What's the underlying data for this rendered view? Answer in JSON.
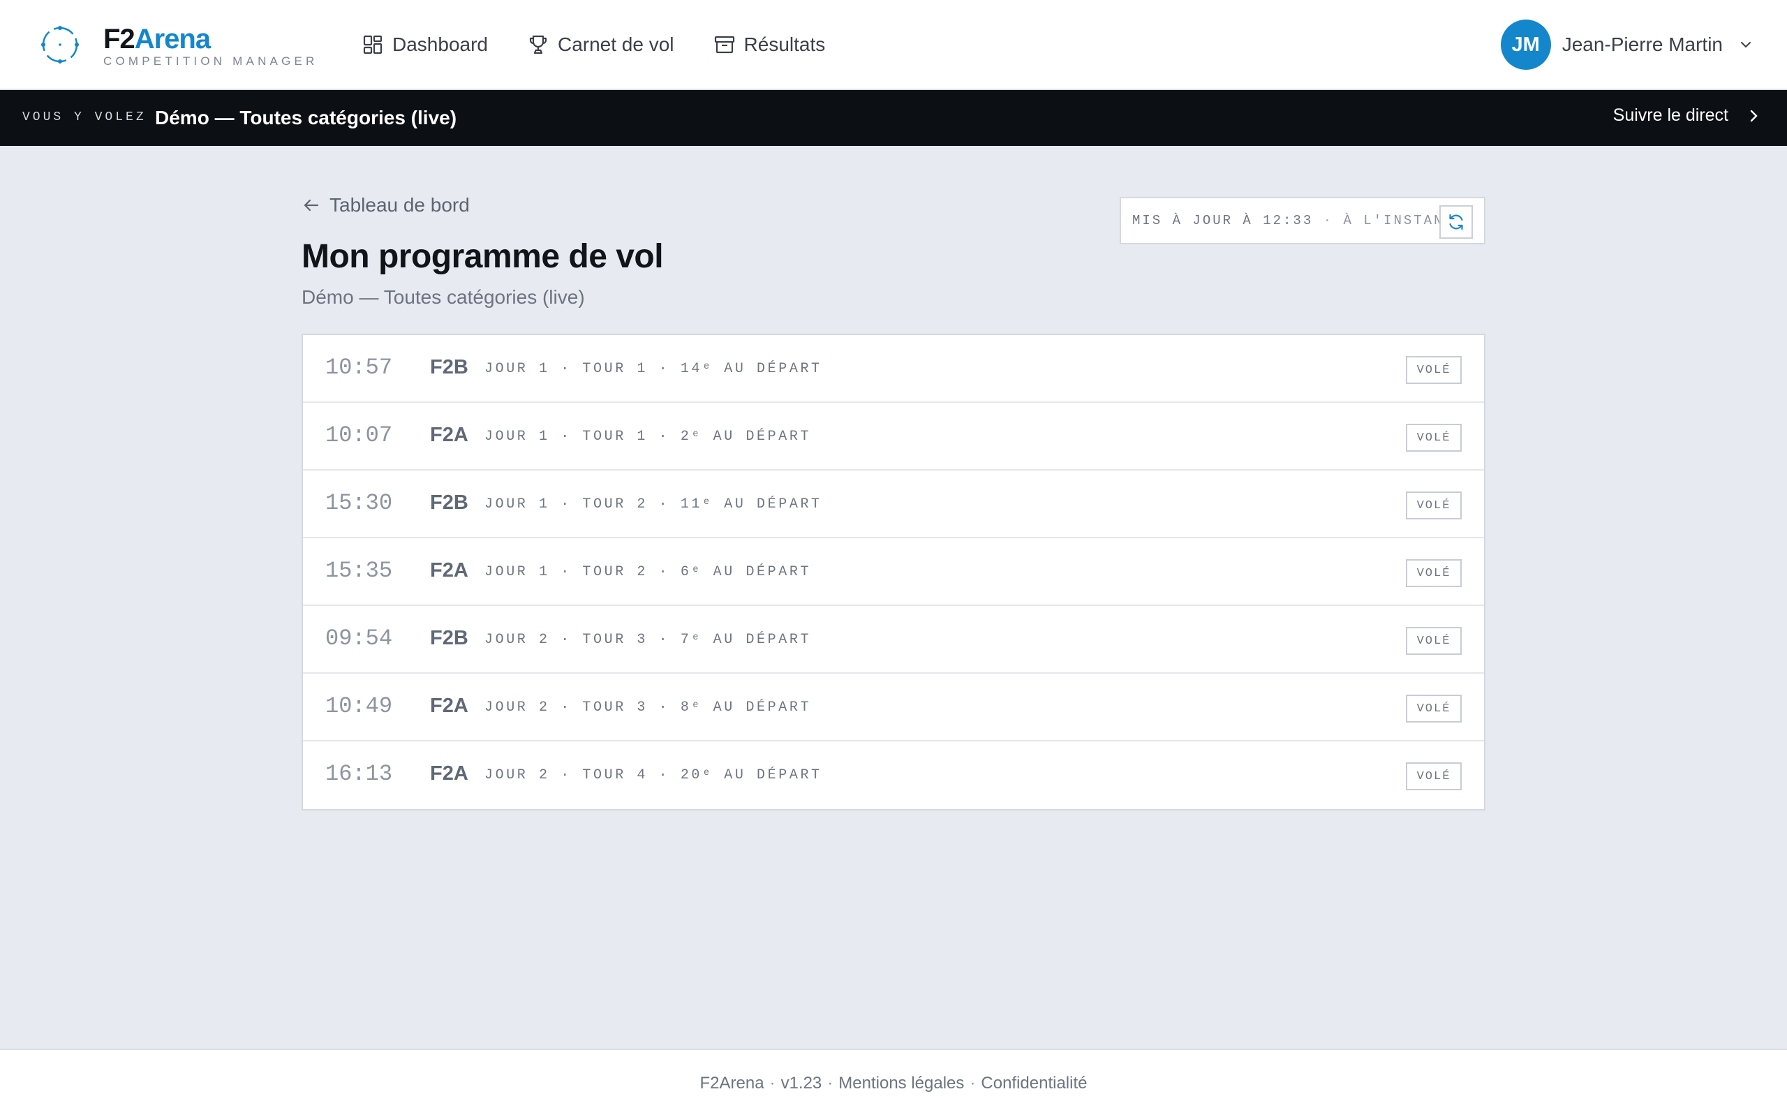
{
  "brand": {
    "name_part1": "F2",
    "name_part2": "Arena",
    "tagline": "COMPETITION MANAGER",
    "logo_icon": "crosshair-circle-icon",
    "accent_color": "#1486cc"
  },
  "nav": {
    "items": [
      {
        "label": "Dashboard",
        "icon": "grid-icon"
      },
      {
        "label": "Carnet de vol",
        "icon": "trophy-icon"
      },
      {
        "label": "Résultats",
        "icon": "archive-icon"
      }
    ]
  },
  "user": {
    "initials": "JM",
    "name": "Jean-Pierre Martin",
    "menu_icon": "chevron-down-icon"
  },
  "banner": {
    "tag": "VOUS Y VOLEZ",
    "competition": "Démo — Toutes catégories (live)",
    "link_label": "Suivre le direct",
    "link_icon": "chevron-right-icon"
  },
  "page": {
    "back_label": "Tableau de bord",
    "title": "Mon programme de vol",
    "subtitle": "Démo — Toutes catégories (live)"
  },
  "refresh": {
    "updated_label": "MIS À JOUR À 12:33",
    "separator": "·",
    "ago_label": "À L'INSTANT",
    "button_icon": "refresh-icon"
  },
  "schedule": [
    {
      "time": "10:57",
      "category": "F2B",
      "details": "JOUR 1 · TOUR 1 · 14ᵉ AU DÉPART",
      "status": "VOLÉ"
    },
    {
      "time": "10:07",
      "category": "F2A",
      "details": "JOUR 1 · TOUR 1 · 2ᵉ AU DÉPART",
      "status": "VOLÉ"
    },
    {
      "time": "15:30",
      "category": "F2B",
      "details": "JOUR 1 · TOUR 2 · 11ᵉ AU DÉPART",
      "status": "VOLÉ"
    },
    {
      "time": "15:35",
      "category": "F2A",
      "details": "JOUR 1 · TOUR 2 · 6ᵉ AU DÉPART",
      "status": "VOLÉ"
    },
    {
      "time": "09:54",
      "category": "F2B",
      "details": "JOUR 2 · TOUR 3 · 7ᵉ AU DÉPART",
      "status": "VOLÉ"
    },
    {
      "time": "10:49",
      "category": "F2A",
      "details": "JOUR 2 · TOUR 3 · 8ᵉ AU DÉPART",
      "status": "VOLÉ"
    },
    {
      "time": "16:13",
      "category": "F2A",
      "details": "JOUR 2 · TOUR 4 · 20ᵉ AU DÉPART",
      "status": "VOLÉ"
    }
  ],
  "footer": {
    "app": "F2Arena",
    "version": "v1.23",
    "legal": "Mentions légales",
    "privacy": "Confidentialité",
    "separator": "·"
  }
}
